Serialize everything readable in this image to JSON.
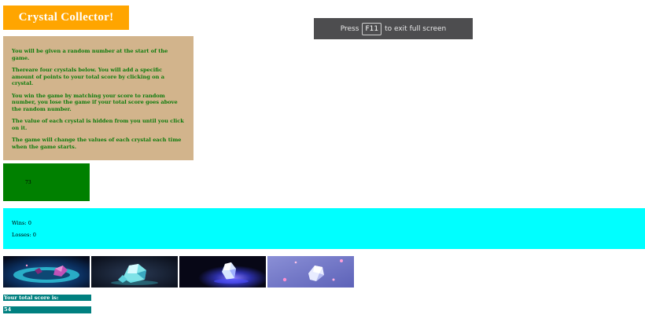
{
  "title": "Crystal Collector!",
  "fullscreen_toast": {
    "prefix": "Press",
    "key": "F11",
    "suffix": "to exit full screen"
  },
  "instructions": [
    "You will be given a random number at the start of the game.",
    "Thereare four crystals below. You will add a specific amount of points to your total score by clicking on a crystal.",
    "You win the game by matching your score to random number, you lose the game if your total score goes above the random number.",
    "The value of each crystal is hidden from you until you click on it.",
    "The game will change the values of each crystal each time when the game starts."
  ],
  "target_number": "73",
  "stats": {
    "wins_label": "Wins:",
    "wins": "0",
    "losses_label": "Losses:",
    "losses": "0"
  },
  "crystals": [
    {
      "icon": "crystal-image-1"
    },
    {
      "icon": "crystal-image-2"
    },
    {
      "icon": "crystal-image-3"
    },
    {
      "icon": "crystal-image-4"
    }
  ],
  "score": {
    "label": "Your total score is:",
    "value": "54"
  },
  "colors": {
    "title_bg": "#ffa500",
    "instructions_bg": "#d2b48c",
    "instructions_text": "#0a7a0a",
    "target_bg": "#008000",
    "stats_bg": "#00ffff",
    "score_bg": "#008080"
  }
}
